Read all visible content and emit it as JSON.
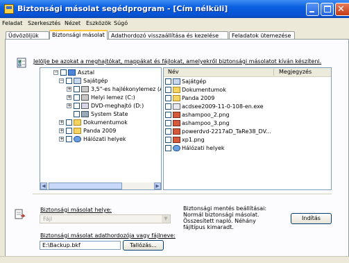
{
  "window": {
    "title": "Biztonsági másolat segédprogram - [Cím nélküli]"
  },
  "menu": [
    "Feladat",
    "Szerkesztés",
    "Nézet",
    "Eszközök",
    "Súgó"
  ],
  "tabs": [
    {
      "label": "Üdvözöljük",
      "active": false
    },
    {
      "label": "Biztonsági másolat",
      "active": true
    },
    {
      "label": "Adathordozó visszaállítása és kezelése",
      "active": false
    },
    {
      "label": "Feladatok ütemezése",
      "active": false
    }
  ],
  "instruction": "Jelölje be azokat a meghajtókat, mappákat és fájlokat, amelyekről biztonsági másolatot kíván készíteni.",
  "tree": [
    {
      "label": "Asztal",
      "icon": "desktop-icon",
      "indent": 0,
      "expander": "-"
    },
    {
      "label": "Sajátgép",
      "icon": "computer-icon",
      "indent": 1,
      "expander": "-"
    },
    {
      "label": "3,5\"-es hajlékonylemez (A",
      "icon": "floppy-icon",
      "indent": 2,
      "expander": "+"
    },
    {
      "label": "Helyi lemez (C:)",
      "icon": "drive-icon",
      "indent": 2,
      "expander": "+"
    },
    {
      "label": "DVD-meghajtó (D:)",
      "icon": "dvd-icon",
      "indent": 2,
      "expander": "+"
    },
    {
      "label": "System State",
      "icon": "system-state-icon",
      "indent": 2,
      "expander": ""
    },
    {
      "label": "Dokumentumok",
      "icon": "folder-icon",
      "indent": 1,
      "expander": "+"
    },
    {
      "label": "Panda 2009",
      "icon": "folder-icon",
      "indent": 1,
      "expander": "+"
    },
    {
      "label": "Hálózati helyek",
      "icon": "network-icon",
      "indent": 1,
      "expander": "+"
    }
  ],
  "list": {
    "columns": [
      "Név",
      "Megjegyzés"
    ],
    "items": [
      {
        "label": "Sajátgép",
        "icon": "computer-icon"
      },
      {
        "label": "Dokumentumok",
        "icon": "folder-icon"
      },
      {
        "label": "Panda 2009",
        "icon": "folder-icon"
      },
      {
        "label": "acdsee2009-11-0-108-en.exe",
        "icon": "exe-icon"
      },
      {
        "label": "ashampoo_2.png",
        "icon": "image-icon"
      },
      {
        "label": "ashampoo_3.png",
        "icon": "image-icon"
      },
      {
        "label": "powerdvd-2217aD_TaRe38_DV...",
        "icon": "image-icon"
      },
      {
        "label": "xp1.png",
        "icon": "image-icon"
      },
      {
        "label": "Hálózati helyek",
        "icon": "network-icon"
      }
    ]
  },
  "destination": {
    "label": "Biztonsági másolat helye:",
    "value": "Fájl"
  },
  "media": {
    "label": "Biztonsági másolat adathordozója vagy fájlneve:",
    "value": "E:\\Backup.bkf",
    "browse_label": "Tallózás..."
  },
  "settings": {
    "title": "Biztonsági mentés beállításai:",
    "lines": [
      "Normál biztonsági másolat.",
      "Összesített napló. Néhány",
      "fájltípus kimaradt."
    ]
  },
  "start_label": "Indítás"
}
